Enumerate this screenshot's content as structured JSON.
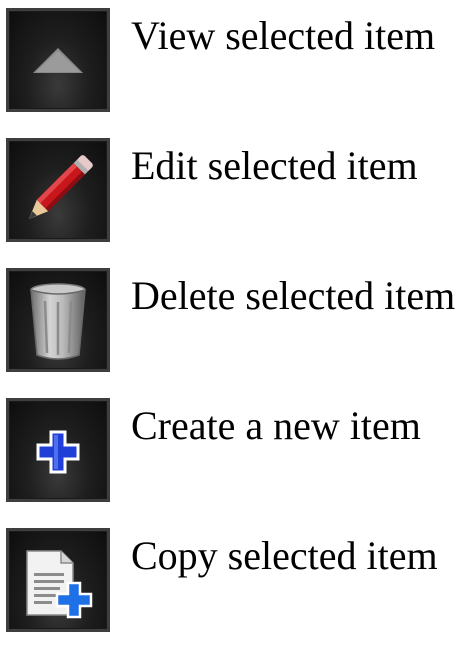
{
  "legend": {
    "items": [
      {
        "icon": "triangle-up-icon",
        "label": "View selected item"
      },
      {
        "icon": "pencil-icon",
        "label": "Edit selected item"
      },
      {
        "icon": "trash-can-icon",
        "label": "Delete selected item"
      },
      {
        "icon": "plus-icon",
        "label": "Create a new item"
      },
      {
        "icon": "copy-document-icon",
        "label": "Copy selected item"
      }
    ]
  },
  "colors": {
    "button_background": "#141414",
    "button_border": "#3e3e3e",
    "plus_blue": "#1f3fd6",
    "pencil_red": "#c8161d",
    "label_text": "#000000"
  }
}
